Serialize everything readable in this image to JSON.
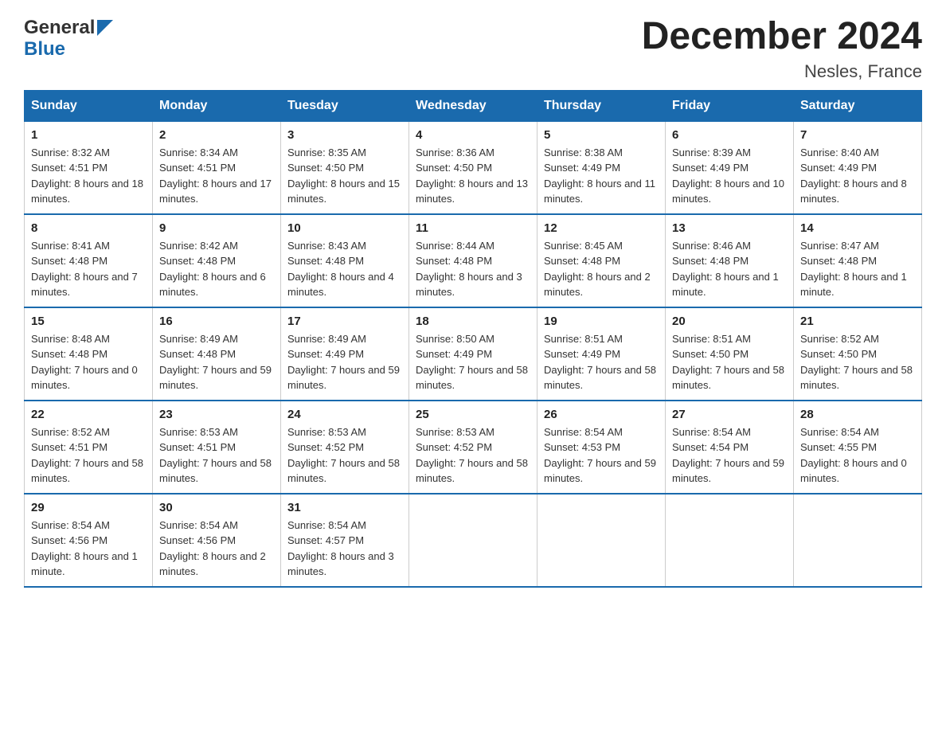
{
  "header": {
    "logo_general": "General",
    "logo_blue": "Blue",
    "title": "December 2024",
    "subtitle": "Nesles, France"
  },
  "days_of_week": [
    "Sunday",
    "Monday",
    "Tuesday",
    "Wednesday",
    "Thursday",
    "Friday",
    "Saturday"
  ],
  "weeks": [
    [
      {
        "day": "1",
        "sunrise": "8:32 AM",
        "sunset": "4:51 PM",
        "daylight": "8 hours and 18 minutes."
      },
      {
        "day": "2",
        "sunrise": "8:34 AM",
        "sunset": "4:51 PM",
        "daylight": "8 hours and 17 minutes."
      },
      {
        "day": "3",
        "sunrise": "8:35 AM",
        "sunset": "4:50 PM",
        "daylight": "8 hours and 15 minutes."
      },
      {
        "day": "4",
        "sunrise": "8:36 AM",
        "sunset": "4:50 PM",
        "daylight": "8 hours and 13 minutes."
      },
      {
        "day": "5",
        "sunrise": "8:38 AM",
        "sunset": "4:49 PM",
        "daylight": "8 hours and 11 minutes."
      },
      {
        "day": "6",
        "sunrise": "8:39 AM",
        "sunset": "4:49 PM",
        "daylight": "8 hours and 10 minutes."
      },
      {
        "day": "7",
        "sunrise": "8:40 AM",
        "sunset": "4:49 PM",
        "daylight": "8 hours and 8 minutes."
      }
    ],
    [
      {
        "day": "8",
        "sunrise": "8:41 AM",
        "sunset": "4:48 PM",
        "daylight": "8 hours and 7 minutes."
      },
      {
        "day": "9",
        "sunrise": "8:42 AM",
        "sunset": "4:48 PM",
        "daylight": "8 hours and 6 minutes."
      },
      {
        "day": "10",
        "sunrise": "8:43 AM",
        "sunset": "4:48 PM",
        "daylight": "8 hours and 4 minutes."
      },
      {
        "day": "11",
        "sunrise": "8:44 AM",
        "sunset": "4:48 PM",
        "daylight": "8 hours and 3 minutes."
      },
      {
        "day": "12",
        "sunrise": "8:45 AM",
        "sunset": "4:48 PM",
        "daylight": "8 hours and 2 minutes."
      },
      {
        "day": "13",
        "sunrise": "8:46 AM",
        "sunset": "4:48 PM",
        "daylight": "8 hours and 1 minute."
      },
      {
        "day": "14",
        "sunrise": "8:47 AM",
        "sunset": "4:48 PM",
        "daylight": "8 hours and 1 minute."
      }
    ],
    [
      {
        "day": "15",
        "sunrise": "8:48 AM",
        "sunset": "4:48 PM",
        "daylight": "7 hours and 0 minutes."
      },
      {
        "day": "16",
        "sunrise": "8:49 AM",
        "sunset": "4:48 PM",
        "daylight": "7 hours and 59 minutes."
      },
      {
        "day": "17",
        "sunrise": "8:49 AM",
        "sunset": "4:49 PM",
        "daylight": "7 hours and 59 minutes."
      },
      {
        "day": "18",
        "sunrise": "8:50 AM",
        "sunset": "4:49 PM",
        "daylight": "7 hours and 58 minutes."
      },
      {
        "day": "19",
        "sunrise": "8:51 AM",
        "sunset": "4:49 PM",
        "daylight": "7 hours and 58 minutes."
      },
      {
        "day": "20",
        "sunrise": "8:51 AM",
        "sunset": "4:50 PM",
        "daylight": "7 hours and 58 minutes."
      },
      {
        "day": "21",
        "sunrise": "8:52 AM",
        "sunset": "4:50 PM",
        "daylight": "7 hours and 58 minutes."
      }
    ],
    [
      {
        "day": "22",
        "sunrise": "8:52 AM",
        "sunset": "4:51 PM",
        "daylight": "7 hours and 58 minutes."
      },
      {
        "day": "23",
        "sunrise": "8:53 AM",
        "sunset": "4:51 PM",
        "daylight": "7 hours and 58 minutes."
      },
      {
        "day": "24",
        "sunrise": "8:53 AM",
        "sunset": "4:52 PM",
        "daylight": "7 hours and 58 minutes."
      },
      {
        "day": "25",
        "sunrise": "8:53 AM",
        "sunset": "4:52 PM",
        "daylight": "7 hours and 58 minutes."
      },
      {
        "day": "26",
        "sunrise": "8:54 AM",
        "sunset": "4:53 PM",
        "daylight": "7 hours and 59 minutes."
      },
      {
        "day": "27",
        "sunrise": "8:54 AM",
        "sunset": "4:54 PM",
        "daylight": "7 hours and 59 minutes."
      },
      {
        "day": "28",
        "sunrise": "8:54 AM",
        "sunset": "4:55 PM",
        "daylight": "8 hours and 0 minutes."
      }
    ],
    [
      {
        "day": "29",
        "sunrise": "8:54 AM",
        "sunset": "4:56 PM",
        "daylight": "8 hours and 1 minute."
      },
      {
        "day": "30",
        "sunrise": "8:54 AM",
        "sunset": "4:56 PM",
        "daylight": "8 hours and 2 minutes."
      },
      {
        "day": "31",
        "sunrise": "8:54 AM",
        "sunset": "4:57 PM",
        "daylight": "8 hours and 3 minutes."
      },
      null,
      null,
      null,
      null
    ]
  ]
}
